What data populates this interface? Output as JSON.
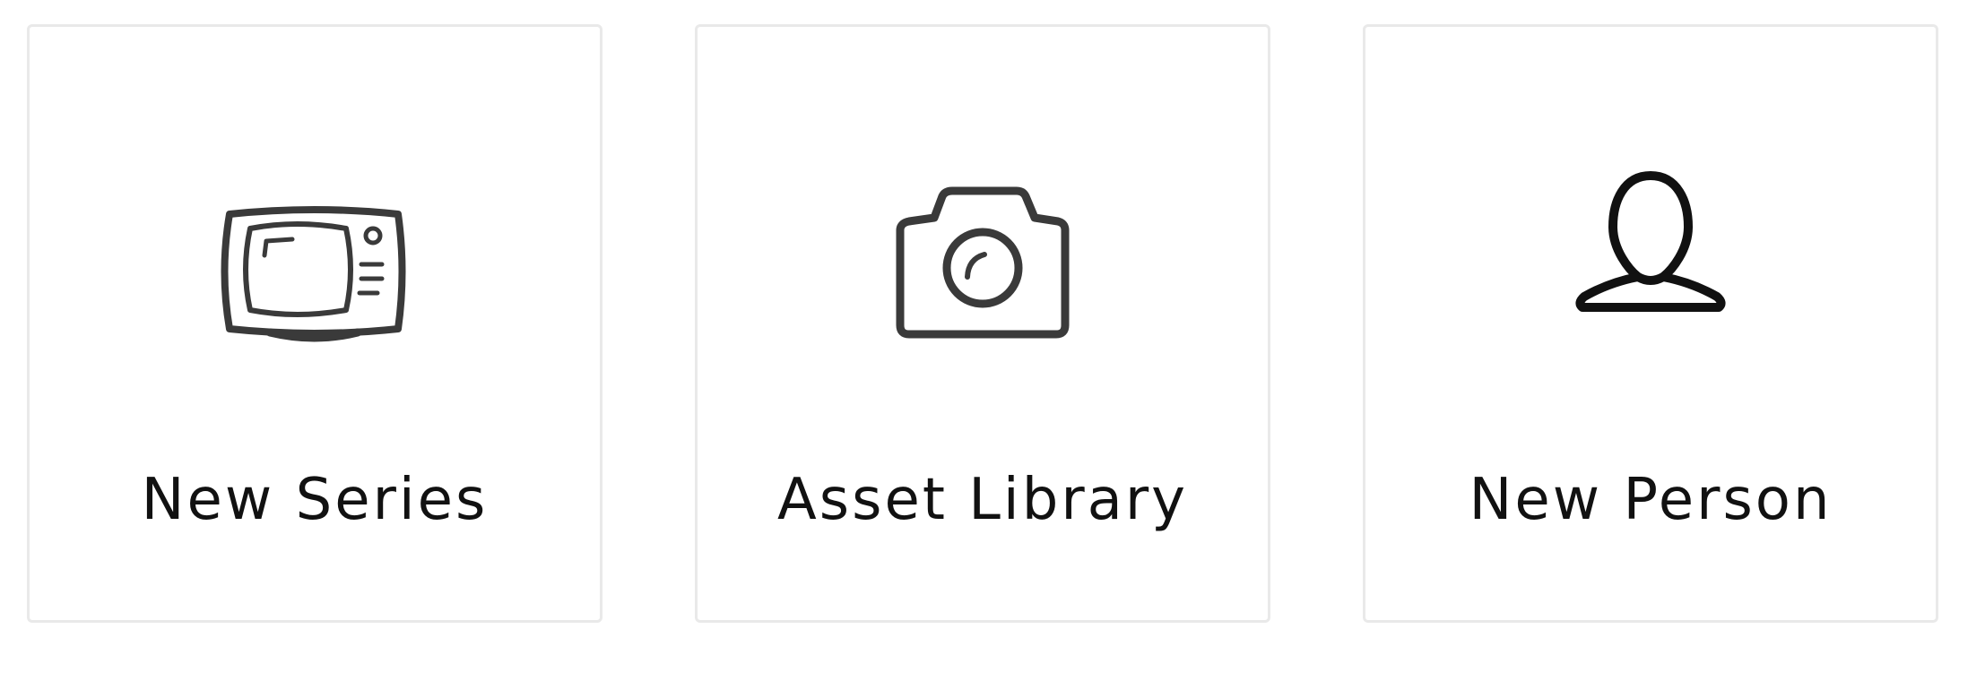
{
  "tiles": [
    {
      "label": "New Series",
      "icon": "tv-icon"
    },
    {
      "label": "Asset Library",
      "icon": "camera-icon"
    },
    {
      "label": "New Person",
      "icon": "person-icon"
    }
  ],
  "colors": {
    "icon_stroke": "#3a3a3a",
    "label_text": "#111111",
    "tile_border": "#e9e9e9",
    "background": "#ffffff"
  }
}
